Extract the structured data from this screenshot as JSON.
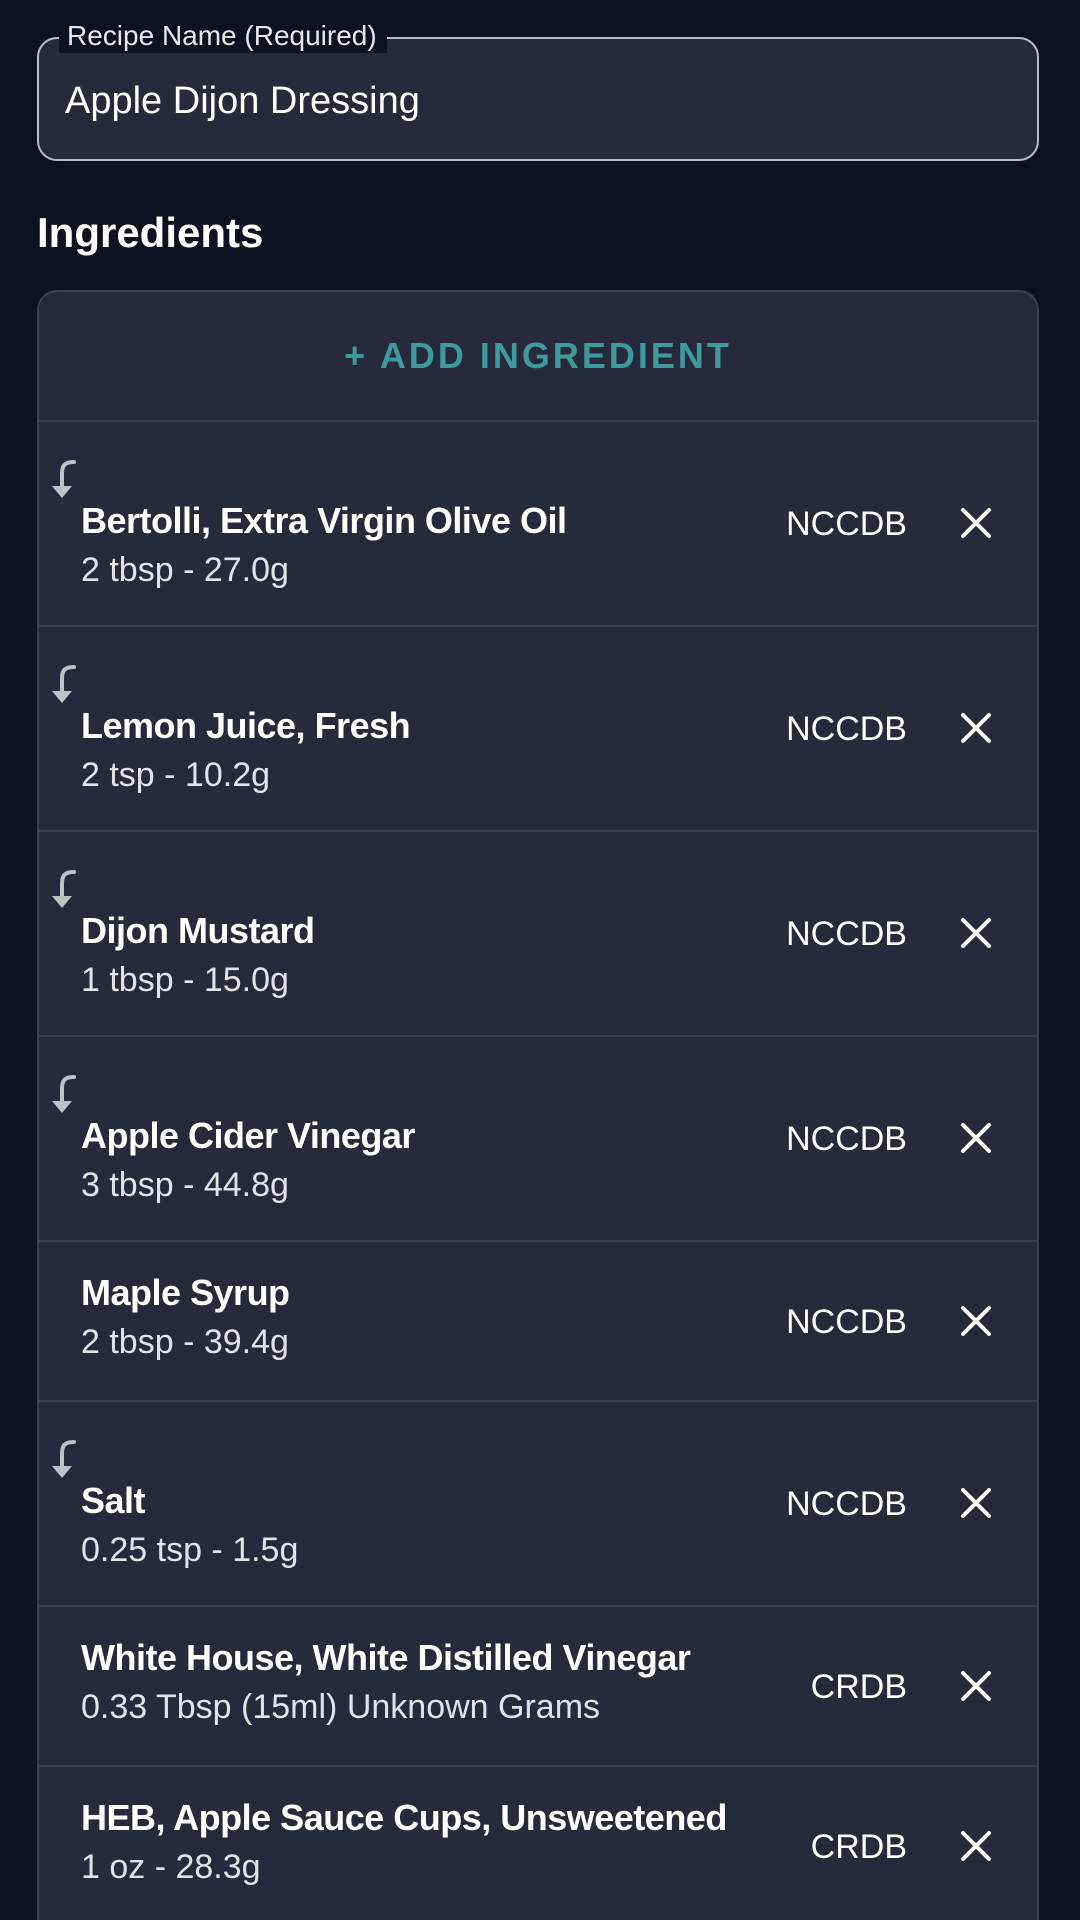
{
  "recipe_name": {
    "label": "Recipe Name (Required)",
    "value": "Apple Dijon Dressing"
  },
  "ingredients": {
    "title": "Ingredients",
    "add_label": "+ ADD INGREDIENT",
    "items": [
      {
        "name": "Bertolli, Extra Virgin Olive Oil",
        "amount": "2 tbsp - 27.0g",
        "source": "NCCDB",
        "icon": "subdirectory-arrow-icon"
      },
      {
        "name": "Lemon Juice, Fresh",
        "amount": "2 tsp - 10.2g",
        "source": "NCCDB",
        "icon": "subdirectory-arrow-icon"
      },
      {
        "name": "Dijon Mustard",
        "amount": "1 tbsp - 15.0g",
        "source": "NCCDB",
        "icon": "subdirectory-arrow-icon"
      },
      {
        "name": "Apple Cider Vinegar",
        "amount": "3 tbsp - 44.8g",
        "source": "NCCDB",
        "icon": "subdirectory-arrow-icon"
      },
      {
        "name": "Maple Syrup",
        "amount": "2 tbsp - 39.4g",
        "source": "NCCDB"
      },
      {
        "name": "Salt",
        "amount": "0.25 tsp - 1.5g",
        "source": "NCCDB",
        "icon": "subdirectory-arrow-icon"
      },
      {
        "name": "White House, White Distilled Vinegar",
        "amount": "0.33 Tbsp (15ml) Unknown Grams",
        "source": "CRDB"
      },
      {
        "name": "HEB, Apple Sauce Cups, Unsweetened",
        "amount": "1 oz - 28.3g",
        "source": "CRDB"
      }
    ]
  },
  "colors": {
    "background": "#0e1120",
    "card": "#262a3b",
    "accent": "#3f9a9c",
    "divider": "#3a3f52"
  }
}
